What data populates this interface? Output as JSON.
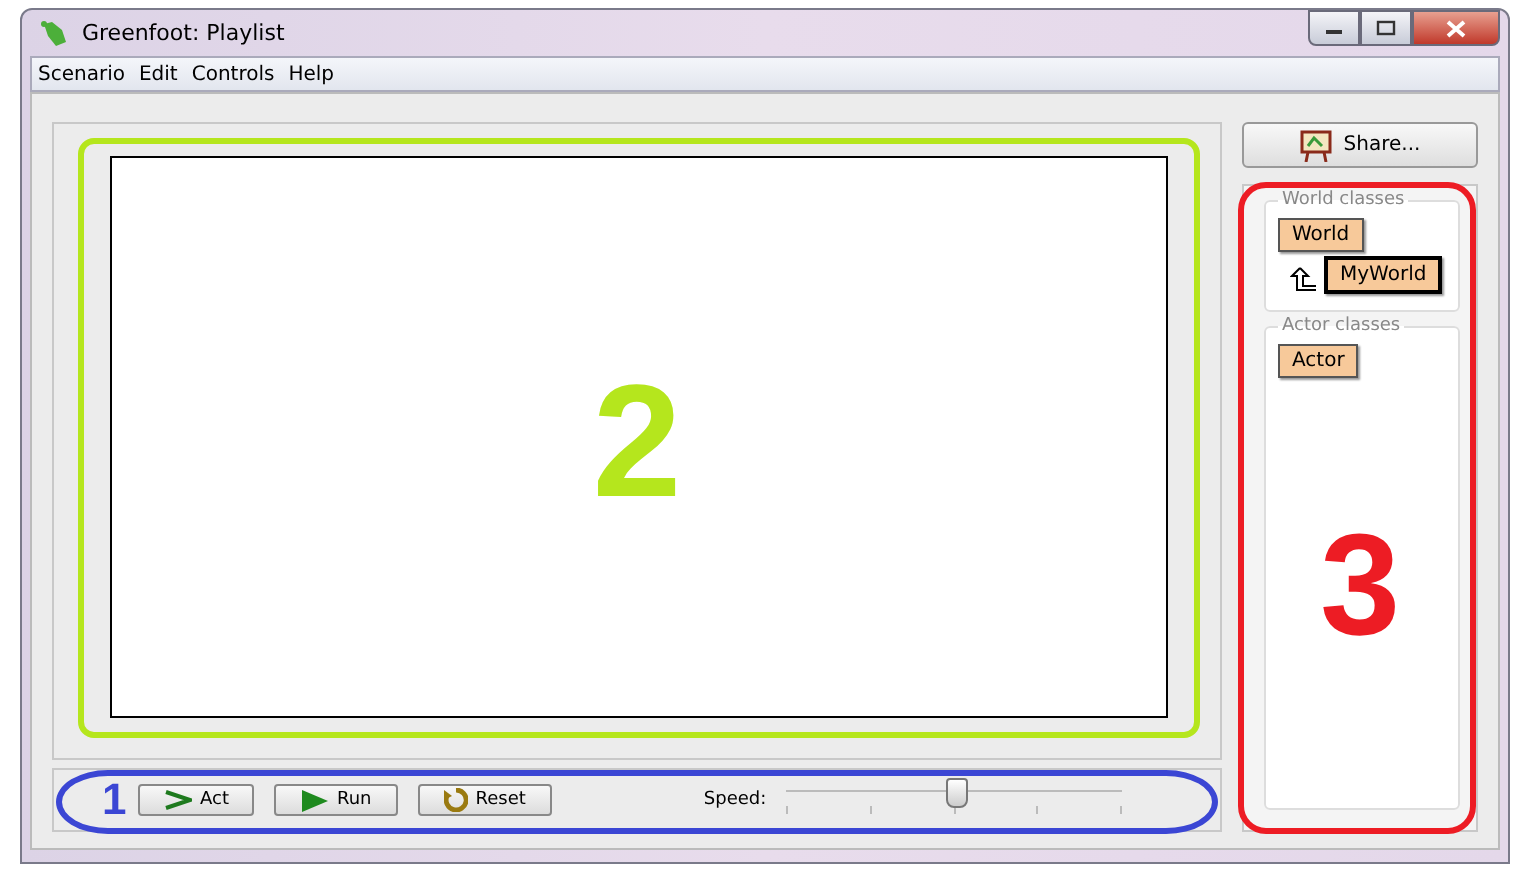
{
  "window": {
    "title": "Greenfoot: Playlist"
  },
  "menu": [
    "Scenario",
    "Edit",
    "Controls",
    "Help"
  ],
  "controls": {
    "buttons": [
      {
        "label": "Act",
        "kind": "act"
      },
      {
        "label": "Run",
        "kind": "run"
      },
      {
        "label": "Reset",
        "kind": "reset"
      }
    ],
    "speed_label": "Speed:",
    "speed": {
      "level": 0.5
    }
  },
  "share_button": "Share...",
  "world_classes": {
    "title": "World classes",
    "classes": [
      {
        "name": "World",
        "selected": false
      },
      {
        "name": "MyWorld",
        "selected": true
      }
    ]
  },
  "actor_classes": {
    "title": "Actor classes",
    "classes": [
      {
        "name": "Actor",
        "selected": false
      }
    ]
  },
  "annotations": [
    {
      "label": "1",
      "color": "#3b46d4"
    },
    {
      "label": "2",
      "color": "#b5e61d"
    },
    {
      "label": "3",
      "color": "#ed1c24"
    }
  ]
}
